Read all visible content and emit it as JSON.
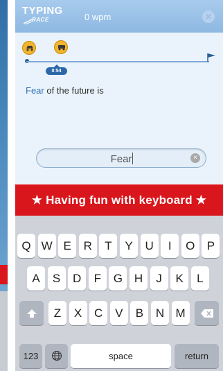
{
  "header": {
    "logo_top": "TYPING",
    "logo_bottom": "RACE",
    "wpm_text": "0 wpm"
  },
  "race": {
    "timer": "0:54"
  },
  "passage": {
    "current_word": "Fear",
    "remaining_text": " of the future is"
  },
  "input": {
    "typed_value": "Fear",
    "clear_glyph": "×"
  },
  "banner": {
    "text": "★ Having fun with keyboard ★"
  },
  "keyboard": {
    "row1": [
      "Q",
      "W",
      "E",
      "R",
      "T",
      "Y",
      "U",
      "I",
      "O",
      "P"
    ],
    "row2": [
      "A",
      "S",
      "D",
      "F",
      "G",
      "H",
      "J",
      "K",
      "L"
    ],
    "row3": [
      "Z",
      "X",
      "C",
      "V",
      "B",
      "N",
      "M"
    ],
    "numbers_label": "123",
    "space_label": "space",
    "return_label": "return",
    "shift_icon": "shift-arrow-icon",
    "delete_icon": "backspace-icon",
    "globe_icon": "globe-icon"
  },
  "colors": {
    "header_blue": "#8eb8e2",
    "banner_red": "#d8161c",
    "word_highlight": "#2f73b7"
  }
}
